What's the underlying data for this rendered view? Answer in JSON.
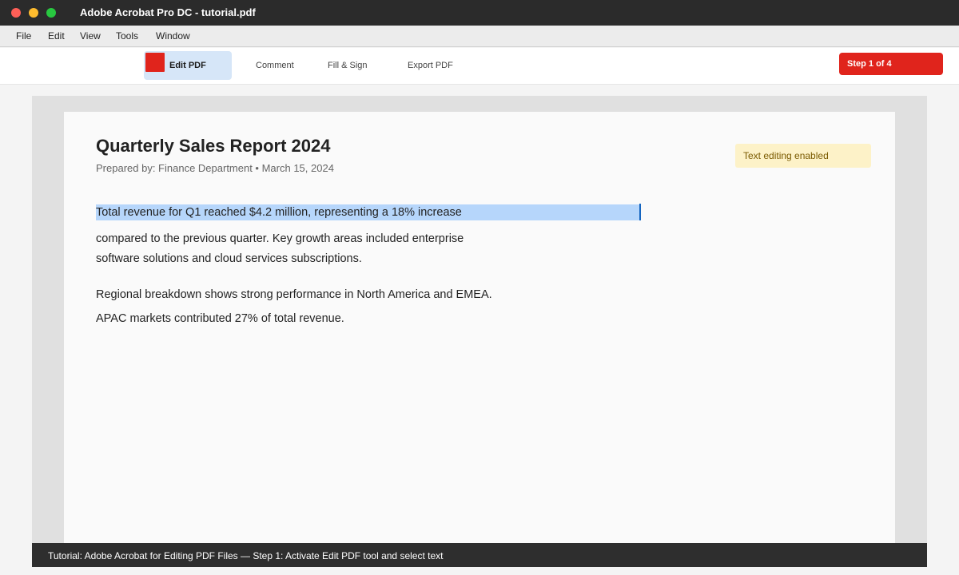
{
  "window": {
    "title": "Adobe Acrobat Pro DC - tutorial.pdf"
  },
  "menu": {
    "items": [
      "File",
      "Edit",
      "View",
      "Tools",
      "Window"
    ]
  },
  "toolbar": {
    "tools": [
      {
        "label": "Edit PDF",
        "active": true,
        "icon": "edit-pdf-icon"
      },
      {
        "label": "Comment",
        "active": false
      },
      {
        "label": "Fill & Sign",
        "active": false
      },
      {
        "label": "Export PDF",
        "active": false
      }
    ],
    "step_badge": "Step 1 of 4"
  },
  "document": {
    "title": "Quarterly Sales Report 2024",
    "subtitle": "Prepared by: Finance Department • March 15, 2024",
    "notice": "Text editing enabled",
    "selected_line": "Total revenue for Q1 reached $4.2 million, representing a 18% increase",
    "paragraph1_lines": [
      "compared to the previous quarter. Key growth areas included enterprise",
      "software solutions and cloud services subscriptions."
    ],
    "paragraph2_lines": [
      "Regional breakdown shows strong performance in North America and EMEA.",
      "APAC markets contributed 27% of total revenue."
    ]
  },
  "tutorial": {
    "caption": "Tutorial: Adobe Acrobat for Editing PDF Files — Step 1: Activate Edit PDF tool and select text"
  },
  "colors": {
    "accent": "#e0241c",
    "selection": "#b6d6fb",
    "active_tool_bg": "#d6e6f8",
    "notice_bg": "#fdf2c8"
  }
}
